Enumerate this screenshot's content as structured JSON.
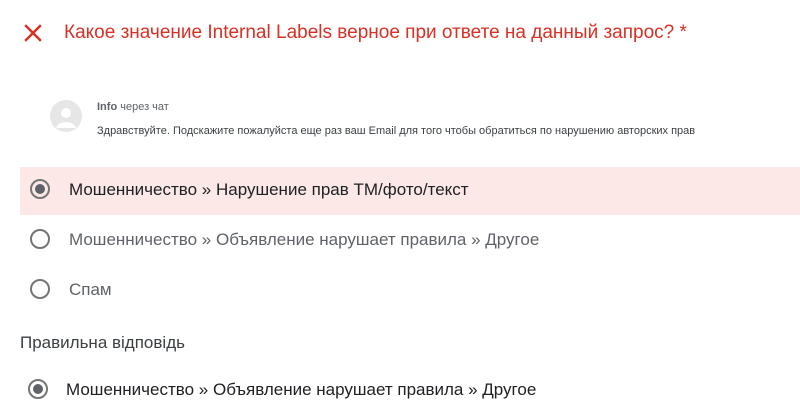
{
  "question": {
    "title": "Какое значение Internal Labels верное при ответе на данный запрос? *",
    "status_icon": "close-icon",
    "accent_color": "#d93025"
  },
  "chat": {
    "sender": "Info",
    "channel": "через чат",
    "message": "Здравствуйте. Подскажите пожалуйста еще раз ваш Email для того чтобы обратиться по нарушению авторских прав",
    "avatar_icon": "person-icon"
  },
  "options": [
    {
      "label": "Мошенничество » Нарушение прав ТМ/фото/текст",
      "selected": true
    },
    {
      "label": "Мошенничество » Объявление нарушает правила » Другое",
      "selected": false
    },
    {
      "label": "Спам",
      "selected": false
    }
  ],
  "correct_answer": {
    "heading": "Правильна відповідь",
    "label": "Мошенничество » Объявление нарушает правила » Другое"
  },
  "colors": {
    "wrong_highlight": "#fce8e6",
    "error_red": "#d93025"
  }
}
